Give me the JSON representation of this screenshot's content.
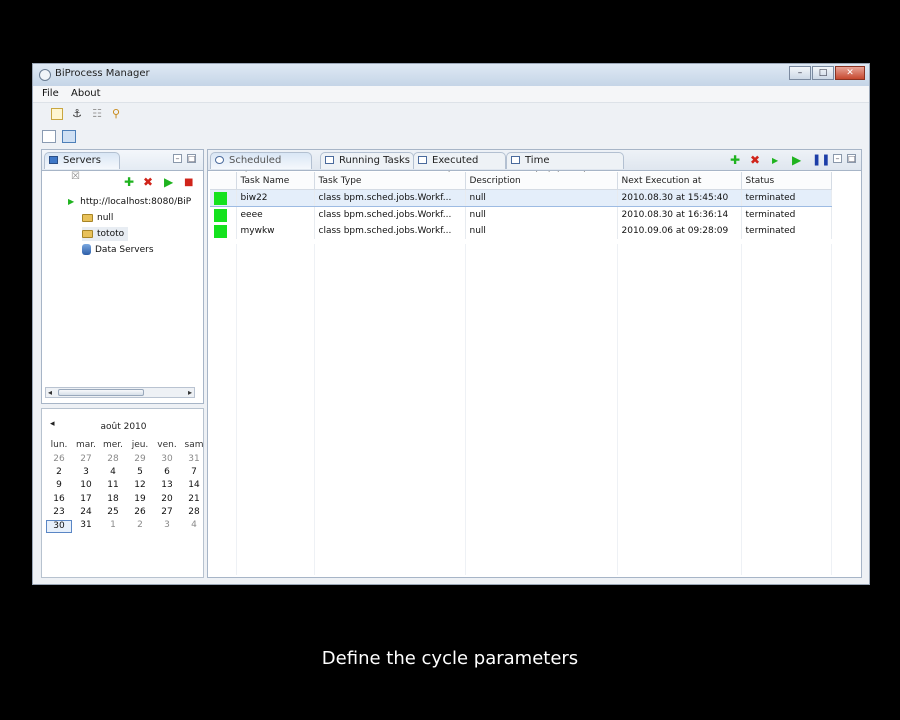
{
  "window": {
    "title": "BiProcess Manager",
    "controls": [
      "–",
      "□",
      "✕"
    ]
  },
  "menu": {
    "file": "File",
    "about": "About"
  },
  "servers_panel": {
    "tab_label": "Servers",
    "tree": {
      "server": "http://localhost:8080/BiP",
      "items": [
        "null",
        "tototo"
      ],
      "data_servers": "Data Servers"
    }
  },
  "calendar": {
    "month_label": "août 2010",
    "prev": "◂",
    "weekdays": [
      "lun.",
      "mar.",
      "mer.",
      "jeu.",
      "ven.",
      "sam"
    ],
    "weeks": [
      [
        "26",
        "27",
        "28",
        "29",
        "30",
        "31"
      ],
      [
        "2",
        "3",
        "4",
        "5",
        "6",
        "7"
      ],
      [
        "9",
        "10",
        "11",
        "12",
        "13",
        "14"
      ],
      [
        "16",
        "17",
        "18",
        "19",
        "20",
        "21"
      ],
      [
        "23",
        "24",
        "25",
        "26",
        "27",
        "28"
      ],
      [
        "30",
        "31",
        "1",
        "2",
        "3",
        "4"
      ]
    ],
    "today": "30"
  },
  "tabs": [
    "Scheduled Tasks",
    "Running Tasks",
    "Executed Tasks",
    "Time Administration"
  ],
  "table": {
    "headers": [
      "Task Name",
      "Task Type",
      "Description",
      "Next Execution at",
      "Status"
    ],
    "rows": [
      {
        "name": "biw22",
        "type": "class bpm.sched.jobs.Workf...",
        "description": "null",
        "next": "2010.08.30 at 15:45:40",
        "status": "terminated"
      },
      {
        "name": "eeee",
        "type": "class bpm.sched.jobs.Workf...",
        "description": "null",
        "next": "2010.08.30 at 16:36:14",
        "status": "terminated"
      },
      {
        "name": "mywkw",
        "type": "class bpm.sched.jobs.Workf...",
        "description": "null",
        "next": "2010.09.06 at 09:28:09",
        "status": "terminated"
      }
    ],
    "status_color": "#14e21e"
  },
  "caption": "Define the cycle parameters"
}
